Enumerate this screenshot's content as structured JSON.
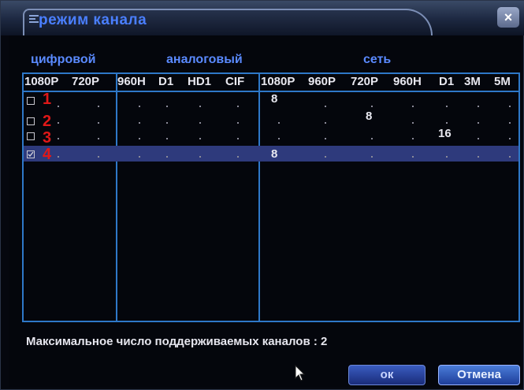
{
  "window": {
    "title": "режим канала",
    "close_symbol": "×"
  },
  "groups": {
    "digital": "цифровой",
    "analog": "аналоговый",
    "network": "сеть"
  },
  "columns": {
    "digital": [
      "1080P",
      "720P"
    ],
    "analog": [
      "960H",
      "D1",
      "HD1",
      "CIF"
    ],
    "network": [
      "1080P",
      "960P",
      "720P",
      "960H",
      "D1",
      "3M",
      "5M"
    ]
  },
  "rows": [
    {
      "marker": "1",
      "checked": false,
      "values": {
        "net_1080P": "8"
      }
    },
    {
      "marker": "2",
      "checked": false,
      "values": {
        "net_720P": "8"
      }
    },
    {
      "marker": "3",
      "checked": false,
      "values": {
        "net_D1": "16"
      }
    },
    {
      "marker": "4",
      "checked": true,
      "selected": true,
      "values": {
        "net_1080P": "8"
      }
    }
  ],
  "status": {
    "max_channels_label": "Максимальное число поддерживаемых каналов : 2"
  },
  "buttons": {
    "ok": "ок",
    "cancel": "Отмена"
  },
  "icons": [
    "close-icon",
    "title-icon",
    "checkbox-icon",
    "mouse-cursor-icon"
  ],
  "colors": {
    "title": "#4a7fff",
    "grid_border": "#2e78c8",
    "selected_row": "#2e3a7c",
    "row_markers": "#e01818"
  }
}
